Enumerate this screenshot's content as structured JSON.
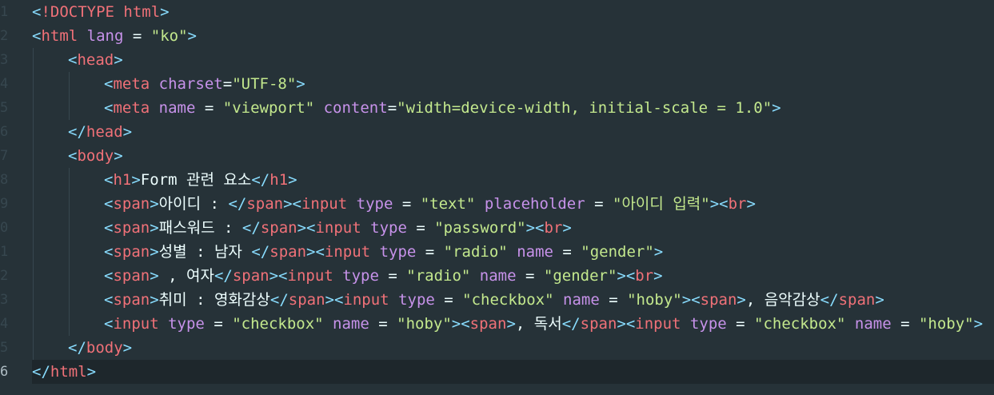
{
  "editor": {
    "theme_colors": {
      "background": "#263238",
      "punctuation": "#89ddff",
      "tag": "#f07178",
      "attribute": "#c792ea",
      "string": "#c3e88d",
      "text": "#eeffff"
    },
    "active_line": 16,
    "line_numbers": [
      "1",
      "2",
      "3",
      "4",
      "5",
      "6",
      "7",
      "8",
      "9",
      "0",
      "1",
      "2",
      "3",
      "4",
      "5",
      "6"
    ],
    "lines": [
      {
        "indent": 0,
        "tokens": [
          [
            "p",
            "<"
          ],
          [
            "t",
            "!DOCTYPE html"
          ],
          [
            "p",
            ">"
          ]
        ]
      },
      {
        "indent": 0,
        "tokens": [
          [
            "p",
            "<"
          ],
          [
            "t",
            "html"
          ],
          [
            "x",
            " "
          ],
          [
            "a",
            "lang"
          ],
          [
            "x",
            " = "
          ],
          [
            "s",
            "\"ko\""
          ],
          [
            "p",
            ">"
          ]
        ]
      },
      {
        "indent": 1,
        "tokens": [
          [
            "p",
            "<"
          ],
          [
            "t",
            "head"
          ],
          [
            "p",
            ">"
          ]
        ]
      },
      {
        "indent": 2,
        "tokens": [
          [
            "p",
            "<"
          ],
          [
            "t",
            "meta"
          ],
          [
            "x",
            " "
          ],
          [
            "a",
            "charset"
          ],
          [
            "x",
            "="
          ],
          [
            "s",
            "\"UTF-8\""
          ],
          [
            "p",
            ">"
          ]
        ]
      },
      {
        "indent": 2,
        "tokens": [
          [
            "p",
            "<"
          ],
          [
            "t",
            "meta"
          ],
          [
            "x",
            " "
          ],
          [
            "a",
            "name"
          ],
          [
            "x",
            " = "
          ],
          [
            "s",
            "\"viewport\""
          ],
          [
            "x",
            " "
          ],
          [
            "a",
            "content"
          ],
          [
            "x",
            "="
          ],
          [
            "s",
            "\"width=device-width, initial-scale = 1.0\""
          ],
          [
            "p",
            ">"
          ]
        ]
      },
      {
        "indent": 1,
        "tokens": [
          [
            "p",
            "</"
          ],
          [
            "t",
            "head"
          ],
          [
            "p",
            ">"
          ]
        ]
      },
      {
        "indent": 1,
        "tokens": [
          [
            "p",
            "<"
          ],
          [
            "t",
            "body"
          ],
          [
            "p",
            ">"
          ]
        ]
      },
      {
        "indent": 2,
        "tokens": [
          [
            "p",
            "<"
          ],
          [
            "t",
            "h1"
          ],
          [
            "p",
            ">"
          ],
          [
            "k",
            "Form 관련 요소"
          ],
          [
            "p",
            "</"
          ],
          [
            "t",
            "h1"
          ],
          [
            "p",
            ">"
          ]
        ]
      },
      {
        "indent": 2,
        "tokens": [
          [
            "p",
            "<"
          ],
          [
            "t",
            "span"
          ],
          [
            "p",
            ">"
          ],
          [
            "k",
            "아이디 : "
          ],
          [
            "p",
            "</"
          ],
          [
            "t",
            "span"
          ],
          [
            "p",
            "><"
          ],
          [
            "t",
            "input"
          ],
          [
            "x",
            " "
          ],
          [
            "a",
            "type"
          ],
          [
            "x",
            " = "
          ],
          [
            "s",
            "\"text\""
          ],
          [
            "x",
            " "
          ],
          [
            "a",
            "placeholder"
          ],
          [
            "x",
            " = "
          ],
          [
            "s",
            "\"아이디 입력\""
          ],
          [
            "p",
            "><"
          ],
          [
            "t",
            "br"
          ],
          [
            "p",
            ">"
          ]
        ]
      },
      {
        "indent": 2,
        "tokens": [
          [
            "p",
            "<"
          ],
          [
            "t",
            "span"
          ],
          [
            "p",
            ">"
          ],
          [
            "k",
            "패스워드 : "
          ],
          [
            "p",
            "</"
          ],
          [
            "t",
            "span"
          ],
          [
            "p",
            "><"
          ],
          [
            "t",
            "input"
          ],
          [
            "x",
            " "
          ],
          [
            "a",
            "type"
          ],
          [
            "x",
            " = "
          ],
          [
            "s",
            "\"password\""
          ],
          [
            "p",
            "><"
          ],
          [
            "t",
            "br"
          ],
          [
            "p",
            ">"
          ]
        ]
      },
      {
        "indent": 2,
        "tokens": [
          [
            "p",
            "<"
          ],
          [
            "t",
            "span"
          ],
          [
            "p",
            ">"
          ],
          [
            "k",
            "성별 : 남자 "
          ],
          [
            "p",
            "</"
          ],
          [
            "t",
            "span"
          ],
          [
            "p",
            "><"
          ],
          [
            "t",
            "input"
          ],
          [
            "x",
            " "
          ],
          [
            "a",
            "type"
          ],
          [
            "x",
            " = "
          ],
          [
            "s",
            "\"radio\""
          ],
          [
            "x",
            " "
          ],
          [
            "a",
            "name"
          ],
          [
            "x",
            " = "
          ],
          [
            "s",
            "\"gender\""
          ],
          [
            "p",
            ">"
          ]
        ]
      },
      {
        "indent": 2,
        "tokens": [
          [
            "p",
            "<"
          ],
          [
            "t",
            "span"
          ],
          [
            "p",
            ">"
          ],
          [
            "k",
            " , 여자"
          ],
          [
            "p",
            "</"
          ],
          [
            "t",
            "span"
          ],
          [
            "p",
            "><"
          ],
          [
            "t",
            "input"
          ],
          [
            "x",
            " "
          ],
          [
            "a",
            "type"
          ],
          [
            "x",
            " = "
          ],
          [
            "s",
            "\"radio\""
          ],
          [
            "x",
            " "
          ],
          [
            "a",
            "name"
          ],
          [
            "x",
            " = "
          ],
          [
            "s",
            "\"gender\""
          ],
          [
            "p",
            "><"
          ],
          [
            "t",
            "br"
          ],
          [
            "p",
            ">"
          ]
        ]
      },
      {
        "indent": 2,
        "tokens": [
          [
            "p",
            "<"
          ],
          [
            "t",
            "span"
          ],
          [
            "p",
            ">"
          ],
          [
            "k",
            "취미 : 영화감상"
          ],
          [
            "p",
            "</"
          ],
          [
            "t",
            "span"
          ],
          [
            "p",
            "><"
          ],
          [
            "t",
            "input"
          ],
          [
            "x",
            " "
          ],
          [
            "a",
            "type"
          ],
          [
            "x",
            " = "
          ],
          [
            "s",
            "\"checkbox\""
          ],
          [
            "x",
            " "
          ],
          [
            "a",
            "name"
          ],
          [
            "x",
            " = "
          ],
          [
            "s",
            "\"hoby\""
          ],
          [
            "p",
            "><"
          ],
          [
            "t",
            "span"
          ],
          [
            "p",
            ">"
          ],
          [
            "k",
            ", 음악감상"
          ],
          [
            "p",
            "</"
          ],
          [
            "t",
            "span"
          ],
          [
            "p",
            ">"
          ]
        ]
      },
      {
        "indent": 2,
        "tokens": [
          [
            "p",
            "<"
          ],
          [
            "t",
            "input"
          ],
          [
            "x",
            " "
          ],
          [
            "a",
            "type"
          ],
          [
            "x",
            " = "
          ],
          [
            "s",
            "\"checkbox\""
          ],
          [
            "x",
            " "
          ],
          [
            "a",
            "name"
          ],
          [
            "x",
            " = "
          ],
          [
            "s",
            "\"hoby\""
          ],
          [
            "p",
            "><"
          ],
          [
            "t",
            "span"
          ],
          [
            "p",
            ">"
          ],
          [
            "k",
            ", 독서"
          ],
          [
            "p",
            "</"
          ],
          [
            "t",
            "span"
          ],
          [
            "p",
            "><"
          ],
          [
            "t",
            "input"
          ],
          [
            "x",
            " "
          ],
          [
            "a",
            "type"
          ],
          [
            "x",
            " = "
          ],
          [
            "s",
            "\"checkbox\""
          ],
          [
            "x",
            " "
          ],
          [
            "a",
            "name"
          ],
          [
            "x",
            " = "
          ],
          [
            "s",
            "\"hoby\""
          ],
          [
            "p",
            ">"
          ]
        ]
      },
      {
        "indent": 1,
        "tokens": [
          [
            "p",
            "</"
          ],
          [
            "t",
            "body"
          ],
          [
            "p",
            ">"
          ]
        ]
      },
      {
        "indent": 0,
        "tokens": [
          [
            "p",
            "</"
          ],
          [
            "t",
            "html"
          ],
          [
            "p",
            ">"
          ]
        ]
      }
    ]
  }
}
